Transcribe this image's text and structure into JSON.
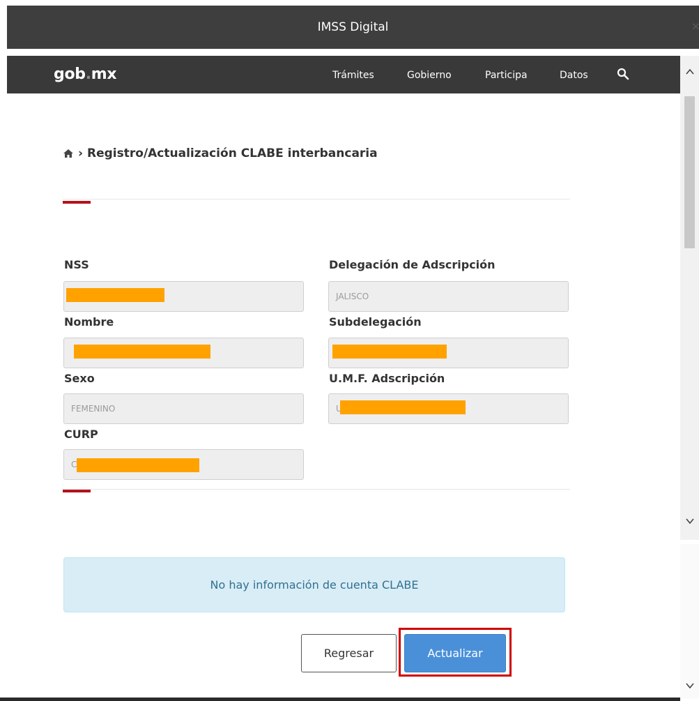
{
  "window": {
    "title": "IMSS Digital",
    "close_glyph": "×"
  },
  "navbar": {
    "brand_left": "gob",
    "brand_dot": ".",
    "brand_right": "mx",
    "items": [
      "Trámites",
      "Gobierno",
      "Participa",
      "Datos"
    ],
    "search_icon": "search-icon"
  },
  "breadcrumb": {
    "home_icon": "home-icon",
    "separator": "›",
    "title": "Registro/Actualización CLABE interbancaria"
  },
  "form": {
    "nss": {
      "label": "NSS",
      "value": ""
    },
    "delegacion": {
      "label": "Delegación de Adscripción",
      "value": "JALISCO"
    },
    "nombre": {
      "label": "Nombre",
      "value": ""
    },
    "subdelegacion": {
      "label": "Subdelegación",
      "value": ""
    },
    "sexo": {
      "label": "Sexo",
      "value": "FEMENINO"
    },
    "umf": {
      "label": "U.M.F. Adscripción",
      "value": "U"
    },
    "curp": {
      "label": "CURP",
      "value": "C"
    }
  },
  "alert": {
    "message": "No hay información de cuenta CLABE"
  },
  "buttons": {
    "back": "Regresar",
    "update": "Actualizar"
  },
  "colors": {
    "accent_red": "#b5121b",
    "button_blue": "#4a90d9",
    "redaction": "#ffa200",
    "alert_bg": "#d9edf7"
  }
}
